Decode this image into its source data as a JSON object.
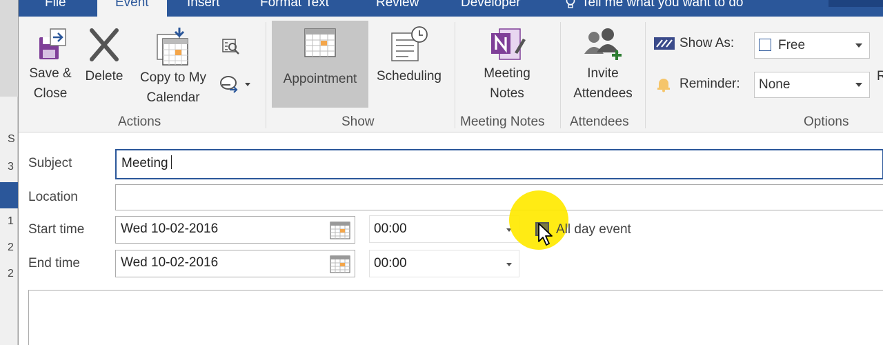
{
  "background_window": {
    "letters": [
      "S",
      "3",
      "1",
      "2",
      "2"
    ]
  },
  "tabs": [
    {
      "label": "File"
    },
    {
      "label": "Event"
    },
    {
      "label": "Insert"
    },
    {
      "label": "Format Text"
    },
    {
      "label": "Review"
    },
    {
      "label": "Developer"
    }
  ],
  "tell_me": "Tell me what you want to do",
  "ribbon": {
    "actions": {
      "save_close_line1": "Save &",
      "save_close_line2": "Close",
      "delete": "Delete",
      "copy_line1": "Copy to My",
      "copy_line2": "Calendar",
      "label": "Actions"
    },
    "show": {
      "appointment": "Appointment",
      "scheduling": "Scheduling",
      "label": "Show"
    },
    "meeting_notes": {
      "btn_line1": "Meeting",
      "btn_line2": "Notes",
      "label": "Meeting Notes"
    },
    "attendees": {
      "btn_line1": "Invite",
      "btn_line2": "Attendees",
      "label": "Attendees"
    },
    "options": {
      "show_as_label": "Show As:",
      "show_as_value": "Free",
      "reminder_label": "Reminder:",
      "reminder_value": "None",
      "label": "Options",
      "cut_off": "R"
    }
  },
  "form": {
    "subject_label": "Subject",
    "subject_value": "Meeting",
    "location_label": "Location",
    "location_value": "",
    "start_label": "Start time",
    "start_date": "Wed 10-02-2016",
    "start_time": "00:00",
    "all_day_label": "All day event",
    "end_label": "End time",
    "end_date": "Wed 10-02-2016",
    "end_time": "00:00"
  },
  "colors": {
    "accent": "#2b579a",
    "ribbon_bg": "#f3f3f3",
    "highlight": "#ffe900"
  },
  "icons": [
    "save-close-icon",
    "delete-icon",
    "copy-calendar-icon",
    "forward-icon",
    "appointment-icon",
    "scheduling-icon",
    "onenote-icon",
    "invite-attendees-icon",
    "show-as-icon",
    "reminder-bell-icon",
    "calendar-picker-icon",
    "mouse-cursor-icon",
    "lightbulb-icon"
  ]
}
